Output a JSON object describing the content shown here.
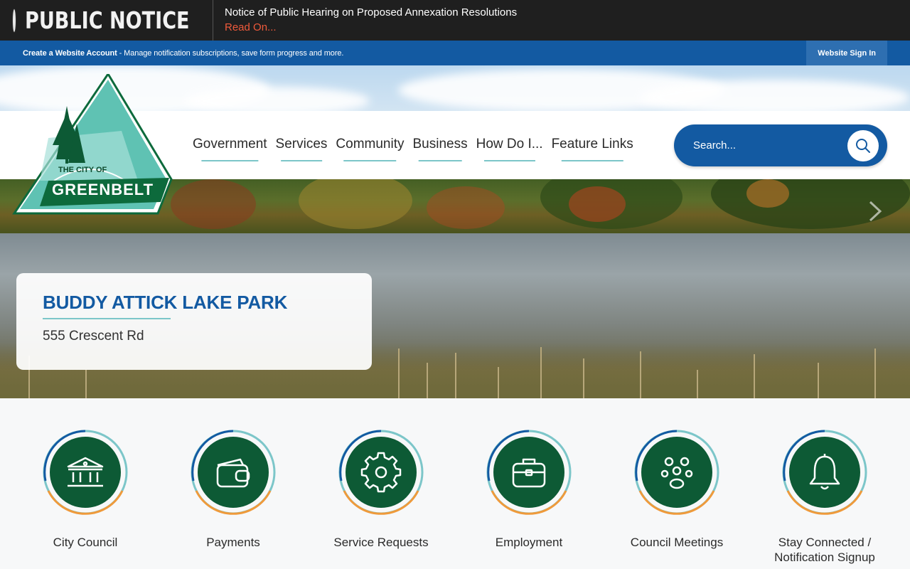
{
  "alert": {
    "badge": "PUBLIC NOTICE",
    "headline": "Notice of Public Hearing on Proposed Annexation Resolutions",
    "link": "Read On..."
  },
  "account": {
    "create_link": "Create a Website Account",
    "description": " - Manage notification subscriptions, save form progress and more.",
    "signin": "Website Sign In"
  },
  "logo": {
    "line1": "THE CITY OF",
    "line2": "GREENBELT"
  },
  "nav": {
    "items": [
      "Government",
      "Services",
      "Community",
      "Business",
      "How Do I...",
      "Feature Links"
    ]
  },
  "search": {
    "placeholder": "Search..."
  },
  "slide": {
    "title": "BUDDY ATTICK LAKE PARK",
    "subtitle": "555 Crescent Rd"
  },
  "quick_links": [
    {
      "label": "City Council",
      "icon": "building-icon"
    },
    {
      "label": "Payments",
      "icon": "wallet-icon"
    },
    {
      "label": "Service Requests",
      "icon": "gear-icon"
    },
    {
      "label": "Employment",
      "icon": "briefcase-icon"
    },
    {
      "label": "Council Meetings",
      "icon": "people-icon"
    },
    {
      "label": "Stay Connected / Notification Signup",
      "icon": "bell-icon"
    }
  ],
  "colors": {
    "brand_blue": "#135aa2",
    "brand_green": "#0d5a35",
    "accent_teal": "#7cc6c9",
    "accent_orange": "#ef9a3b",
    "alert_red": "#ef5a3b"
  }
}
